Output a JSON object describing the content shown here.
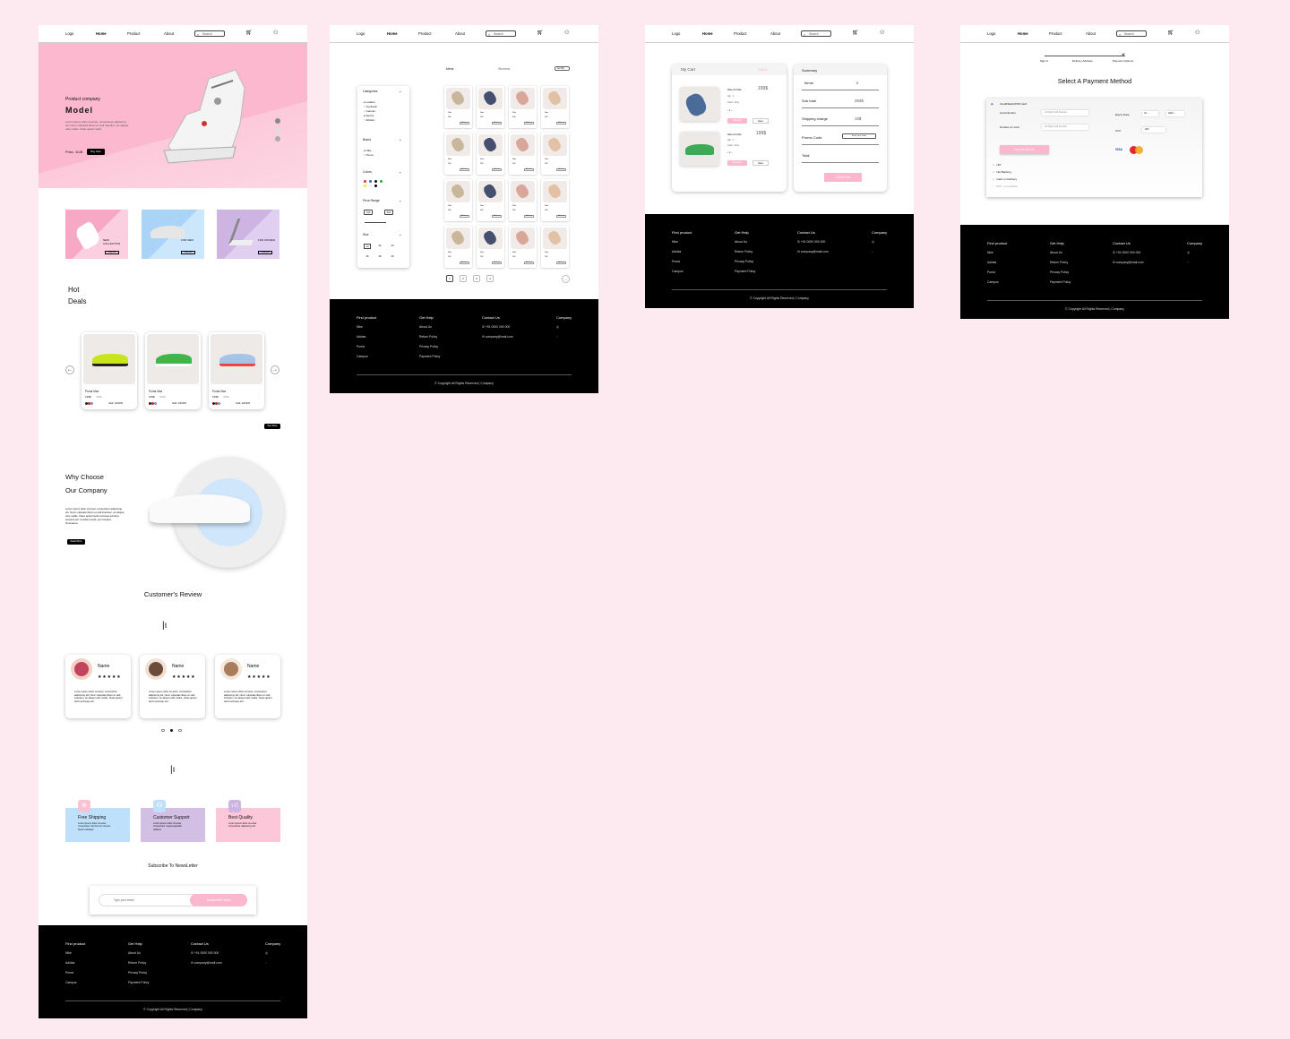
{
  "colors": {
    "background": "#fdeaf0",
    "accent_pink": "#fab7cd",
    "blue": "#bfe0fb",
    "purple": "#d9c5e6",
    "black": "#000000"
  },
  "nav": {
    "logo": "Logo",
    "home": "Home",
    "product": "Product",
    "about": "About",
    "search_placeholder": "Search",
    "cart_icon": "cart-icon",
    "user_icon": "user-icon"
  },
  "home": {
    "hero": {
      "company": "Product company",
      "model": "Model",
      "desc": "Lorem ipsum dolor sit amet, consectetur adipiscing elit. Nunc vulputate libero et velit interdum, ac aliquet odio mattis. Class aptent taciti.",
      "price": "Price- 114$",
      "buy": "Buy Now"
    },
    "collections": [
      {
        "label": "NEW COLLECTION",
        "btn": "Shop Now"
      },
      {
        "label": "FOR MEN",
        "btn": "Shop Now"
      },
      {
        "label": "FOR WOMEN",
        "btn": "Shop Now"
      }
    ],
    "hot_deals_1": "Hot",
    "hot_deals_2": "Deals",
    "deals": [
      {
        "name": "Puma Max",
        "price": "199$",
        "old": "399$",
        "sold": "Sold: 120/400"
      },
      {
        "name": "Puma Max",
        "price": "199$",
        "old": "399$",
        "sold": "Sold: 120/400"
      },
      {
        "name": "Puma Max",
        "price": "199$",
        "old": "399$",
        "sold": "Sold: 120/400"
      }
    ],
    "see_more": "See More",
    "why_1": "Why Choose",
    "why_2": "Our Company",
    "why_desc": "Lorem ipsum dolor sit amet, consectetur adipiscing elit. Nunc vulputate libero et velit interdum, ac aliquet odio mattis. Class aptent taciti sociosqu ad litora torquent per conubia nostra, per inceptos himenaeos.",
    "read_more": "Read More",
    "review_title": "Customer's Review",
    "reviews": [
      {
        "name": "Name",
        "stars": "★★★★★",
        "text": "Lorem ipsum dolor sit amet, consectetur adipiscing elit. Nunc vulputate libero et velit interdum, ac aliquet odio mattis. Class aptent taciti sociosqu ad l."
      },
      {
        "name": "Name",
        "stars": "★★★★★",
        "text": "Lorem ipsum dolor sit amet, consectetur adipiscing elit. Nunc vulputate libero et velit interdum, ac aliquet odio mattis. Class aptent taciti sociosqu ad l."
      },
      {
        "name": "Name",
        "stars": "★★★★★",
        "text": "Lorem ipsum dolor sit amet, consectetur adipiscing elit. Nunc vulputate libero et velit interdum, ac aliquet odio mattis. Class aptent taciti sociosqu ad l."
      }
    ],
    "features": [
      {
        "title": "Free Shipping",
        "text": "Lorem ipsum dolor sit amet consectetur Vel,find nec tempor fuselt morbiqun"
      },
      {
        "title": "Customer Support",
        "text": "Lorem ipsum dolor sit amet consectetur massa papellat nabicus"
      },
      {
        "title": "Best Quality",
        "text": "Lorem ipsum dolor sit amet consectetur adipiscing elit."
      }
    ],
    "newsletter": "Subscribe To  NewsLetter",
    "email_placeholder": "Type your email",
    "subscribe": "Subscribe Now"
  },
  "shop": {
    "tabs": {
      "men": "Mens",
      "women": "Womens",
      "sort": "Sort By"
    },
    "filters": {
      "categories": "Categories",
      "cat_items": [
        "Leather",
        "Synthetic",
        "Canvas",
        "Sports",
        "Athletic"
      ],
      "brand": "Brand",
      "brand_items": [
        "Nike",
        "Puma"
      ],
      "colors": "Colors",
      "price": "Price Range",
      "price_min": "150",
      "price_max": "500",
      "size": "Size",
      "sizes": [
        "24",
        "32",
        "34",
        "36",
        "38",
        "40"
      ]
    },
    "product_label": "Nike",
    "product_price": "99$",
    "product_btn": "Add to cart",
    "pages": [
      "1",
      "2",
      "3",
      "4"
    ],
    "next": "→"
  },
  "cart": {
    "title": "My Cart",
    "count": "2 items",
    "items": [
      {
        "name": "Nike Air Max",
        "qty": "Qty : 1",
        "color": "Color : Grey",
        "price": "199$",
        "remove": "Remove",
        "save": "Save"
      },
      {
        "name": "Nike Air Max",
        "qty": "Qty : 1",
        "color": "Color : Grey",
        "price": "199$",
        "remove": "Remove",
        "save": "Save"
      }
    ],
    "summary": "Summary",
    "items_label": "Items",
    "items_value": "2",
    "subtotal_label": "Sub total",
    "subtotal_value": "393$",
    "shipping_label": "Shipping charge",
    "shipping_value": "10$",
    "promo_label": "Promo Code",
    "promo_placeholder": "Enter your Code",
    "total_label": "Total",
    "checkout": "Check Out"
  },
  "payment": {
    "steps": [
      "Sign in",
      "Delivery Address",
      "Payment Options"
    ],
    "title": "Select A Payment Method",
    "card_option": "Credit/Debit/ATM Card",
    "card_number": "Card Number",
    "card_ph": "16 Digit Card Number",
    "name_on_card": "Number on card",
    "name_ph": "16 Digit Card Number",
    "expiry": "Expiry Date",
    "month": "01",
    "year": "2022",
    "cvv": "CVV",
    "cvv_value": "000",
    "pay": "Pay Rs 500.00",
    "visa": "VISA",
    "options": [
      "UPI",
      "Net Banking",
      "Cash on Delivery",
      "EMI - Unavailable"
    ]
  },
  "footer": {
    "find": "Find product",
    "find_items": [
      "Nike",
      "Adidas",
      "Puma",
      "Campus"
    ],
    "help": "Get Help",
    "help_items": [
      "About Us",
      "Return Policy",
      "Privacy Policy",
      "Payment Policy"
    ],
    "contact": "Contact Us",
    "phone": "+91 0000 000 000",
    "email": "company@mail.com",
    "company": "Company",
    "copyright": "Copyright All Rights Reserved | Company"
  }
}
